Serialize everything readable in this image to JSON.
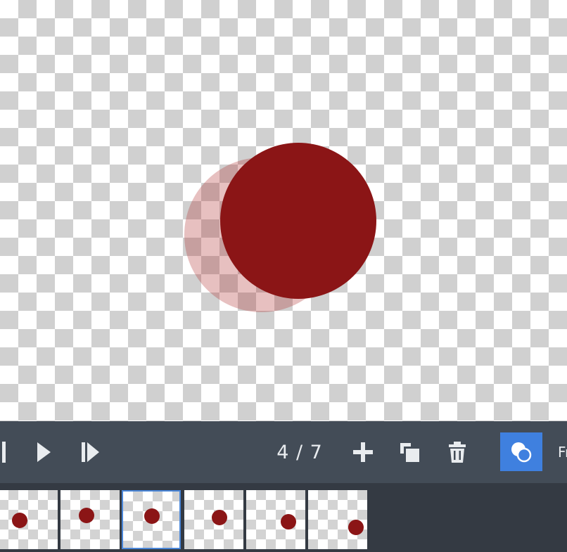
{
  "canvas": {
    "onion_skin_color": "#af2d2d",
    "shape_color": "#8b1516"
  },
  "toolbar": {
    "buttons": [
      {
        "name": "first-frame-button",
        "icon": "skip-back-icon"
      },
      {
        "name": "play-button",
        "icon": "play-icon"
      },
      {
        "name": "next-frame-button",
        "icon": "step-forward-icon"
      }
    ],
    "frame_counter": "4 / 7",
    "actions": [
      {
        "name": "add-frame-button",
        "icon": "plus-icon"
      },
      {
        "name": "duplicate-frame-button",
        "icon": "duplicate-icon"
      },
      {
        "name": "delete-frame-button",
        "icon": "trash-icon"
      }
    ],
    "onion_skin_toggle": {
      "icon": "onion-skin-icon",
      "active": true,
      "active_color": "#3f80df"
    },
    "cut_label": "Fr"
  },
  "filmstrip": {
    "selected_index": 2,
    "frames": [
      {
        "label": "frame-1"
      },
      {
        "label": "frame-2"
      },
      {
        "label": "frame-3"
      },
      {
        "label": "frame-4"
      },
      {
        "label": "frame-5"
      },
      {
        "label": "frame-6"
      }
    ]
  }
}
